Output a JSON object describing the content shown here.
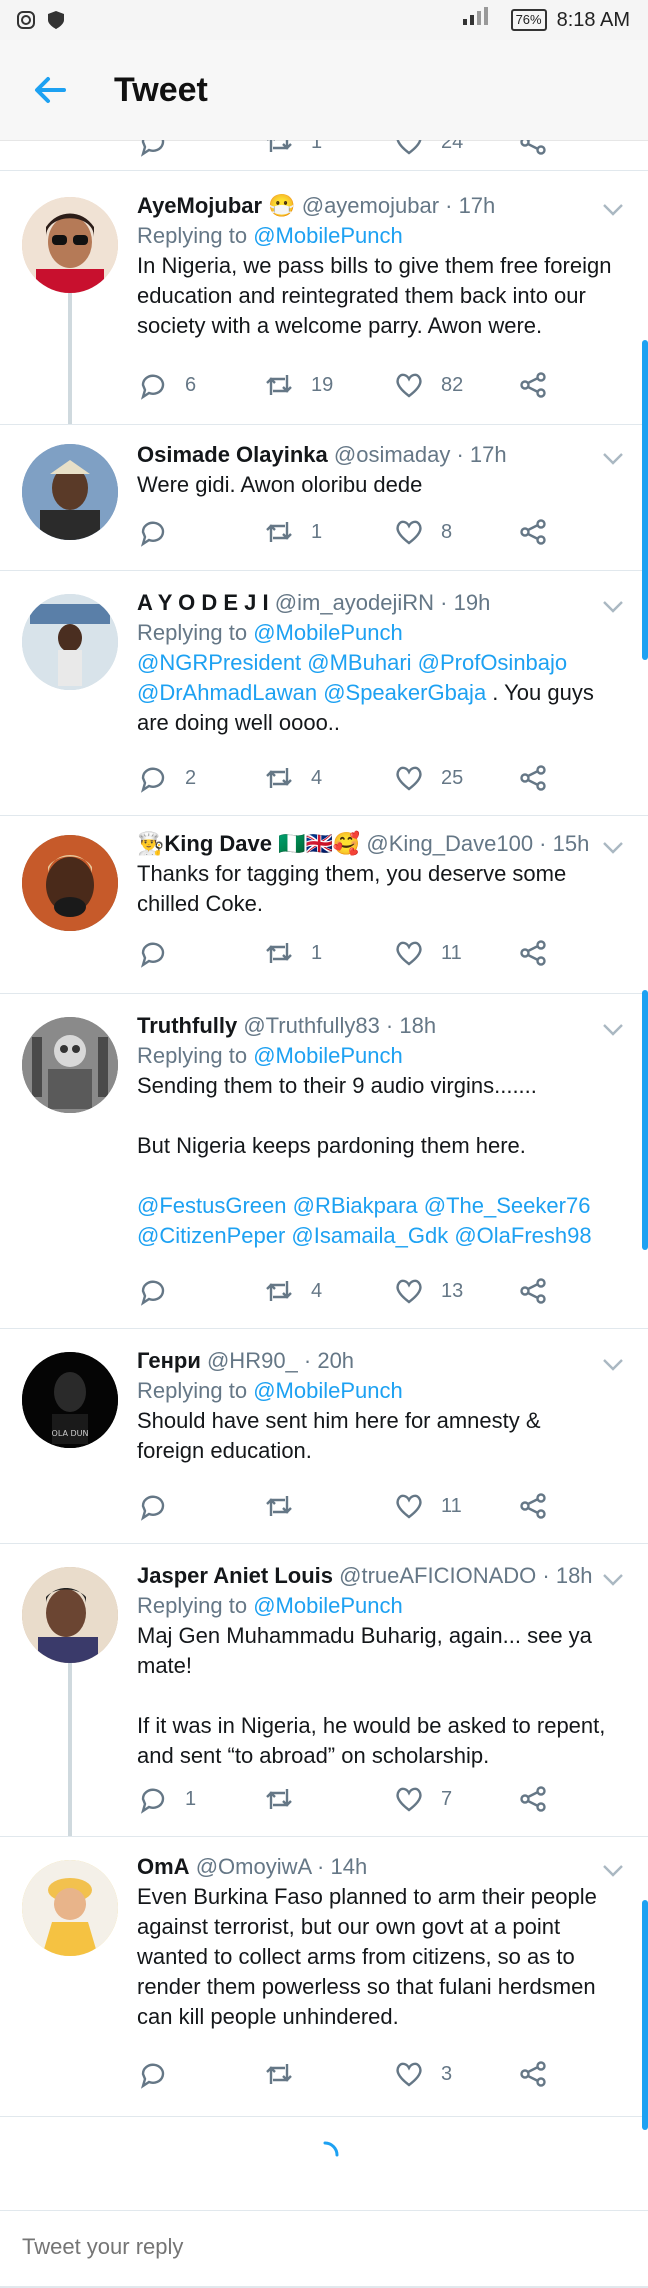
{
  "status_bar": {
    "battery": "76%",
    "time": "8:18 AM"
  },
  "header": {
    "title": "Tweet"
  },
  "partial_tweet": {
    "retweets": "1",
    "likes": "24"
  },
  "reply_prefix": "Replying to",
  "tweets": [
    {
      "name": "AyeMojubar 😷",
      "handle": "@ayemojubar · 17h",
      "replying_to": "@MobilePunch",
      "text": "In Nigeria, we pass bills to give them free foreign education and reintegrated them back into our society with a welcome parry. Awon were.",
      "replies": "6",
      "retweets": "19",
      "likes": "82"
    },
    {
      "name": "Osimade Olayinka",
      "handle": "@osimaday · 17h",
      "text": "Were gidi. Awon oloribu dede",
      "replies": "",
      "retweets": "1",
      "likes": "8"
    },
    {
      "name": "A Y O D E J I",
      "handle": "@im_ayodejiRN · 19h",
      "replying_to": "@MobilePunch",
      "mentions": "@NGRPresident @MBuhari @ProfOsinbajo @DrAhmadLawan @SpeakerGbaja",
      "text_after": " .  You guys are doing well oooo..",
      "replies": "2",
      "retweets": "4",
      "likes": "25"
    },
    {
      "name": "👨‍🍳King Dave 🇳🇬🇬🇧🥰",
      "handle": "@King_Dave100 · 15h",
      "text": "Thanks for tagging them, you deserve some chilled Coke.",
      "replies": "",
      "retweets": "1",
      "likes": "11"
    },
    {
      "name": "Truthfully",
      "handle": "@Truthfully83 · 18h",
      "replying_to": "@MobilePunch",
      "text": "Sending them to their 9 audio virgins.......\n\nBut Nigeria keeps pardoning them here.\n\n",
      "mentions": "@FestusGreen @RBiakpara @The_Seeker76 @CitizenPeper @Isamaila_Gdk @OlaFresh98",
      "replies": "",
      "retweets": "4",
      "likes": "13"
    },
    {
      "name": "Генри",
      "handle": "@HR90_ · 20h",
      "replying_to": "@MobilePunch",
      "text": "Should have sent him here for amnesty & foreign education.",
      "replies": "",
      "retweets": "",
      "likes": "11"
    },
    {
      "name": "Jasper Aniet Louis",
      "handle": "@trueAFICIONADO · 18h",
      "replying_to": "@MobilePunch",
      "text": "Maj Gen Muhammadu Buharig, again... see ya mate!\n\nIf it was in Nigeria, he would be asked to repent, and sent “to abroad” on scholarship.",
      "replies": "1",
      "retweets": "",
      "likes": "7"
    },
    {
      "name": "OmA",
      "handle": "@OmoyiwA · 14h",
      "text": "Even Burkina Faso planned to arm their people against terrorist, but our own govt at a point wanted to collect arms from citizens, so as to render them powerless so that fulani herdsmen can kill people unhindered.",
      "replies": "",
      "retweets": "",
      "likes": "3"
    }
  ],
  "reply_bar": {
    "placeholder": "Tweet your reply"
  },
  "colors": {
    "accent": "#1da1f2",
    "muted": "#657786",
    "divider": "#e1e8ed"
  }
}
